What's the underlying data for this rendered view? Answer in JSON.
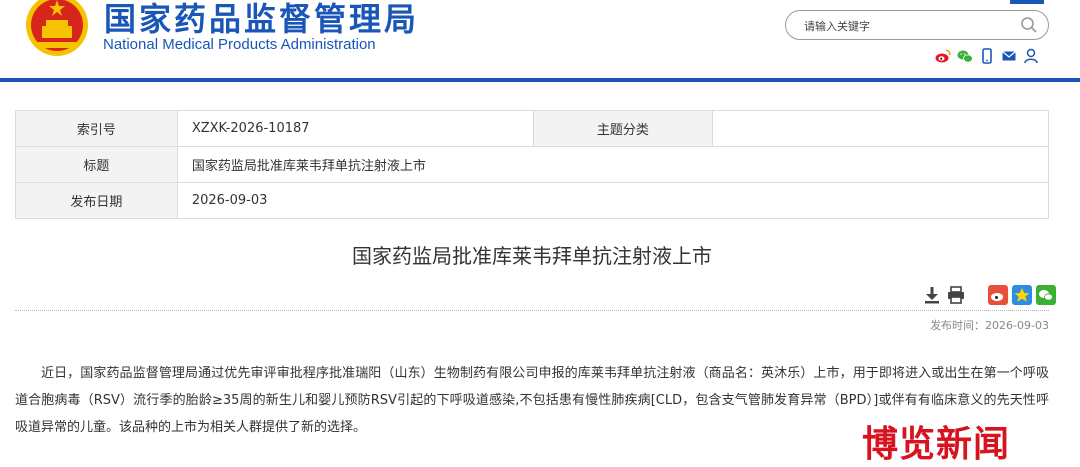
{
  "header": {
    "title_cn": "国家药品监督管理局",
    "title_en": "National Medical Products Administration",
    "search_placeholder": "请输入关键字",
    "social_icons": [
      "weibo-icon",
      "wechat-icon",
      "mobile-icon",
      "mail-icon",
      "user-icon"
    ]
  },
  "info": {
    "index_label": "索引号",
    "index_value": "XZXK-2026-10187",
    "category_label": "主题分类",
    "category_value": "",
    "title_label": "标题",
    "title_value": "国家药监局批准库莱韦拜单抗注射液上市",
    "date_label": "发布日期",
    "date_value": "2026-09-03"
  },
  "article": {
    "title": "国家药监局批准库莱韦拜单抗注射液上市",
    "publish_time_label": "发布时间：",
    "publish_time_value": "2026-09-03",
    "body": "近日，国家药品监督管理局通过优先审评审批程序批准瑞阳（山东）生物制药有限公司申报的库莱韦拜单抗注射液（商品名：英沐乐）上市，用于即将进入或出生在第一个呼吸道合胞病毒（RSV）流行季的胎龄≥35周的新生儿和婴儿预防RSV引起的下呼吸道感染,不包括患有慢性肺疾病[CLD，包含支气管肺发育异常（BPD）]或伴有有临床意义的先天性呼吸道异常的儿童。该品种的上市为相关人群提供了新的选择。"
  },
  "toolbar_icons": [
    "download-icon",
    "print-icon",
    "share-weibo-icon",
    "share-qzone-icon",
    "share-wechat-icon"
  ],
  "watermark": "博览新闻",
  "colors": {
    "brand_blue": "#1a56b8",
    "watermark_red": "#d6131f",
    "emblem_red": "#d8251c",
    "emblem_gold": "#f6c300"
  }
}
